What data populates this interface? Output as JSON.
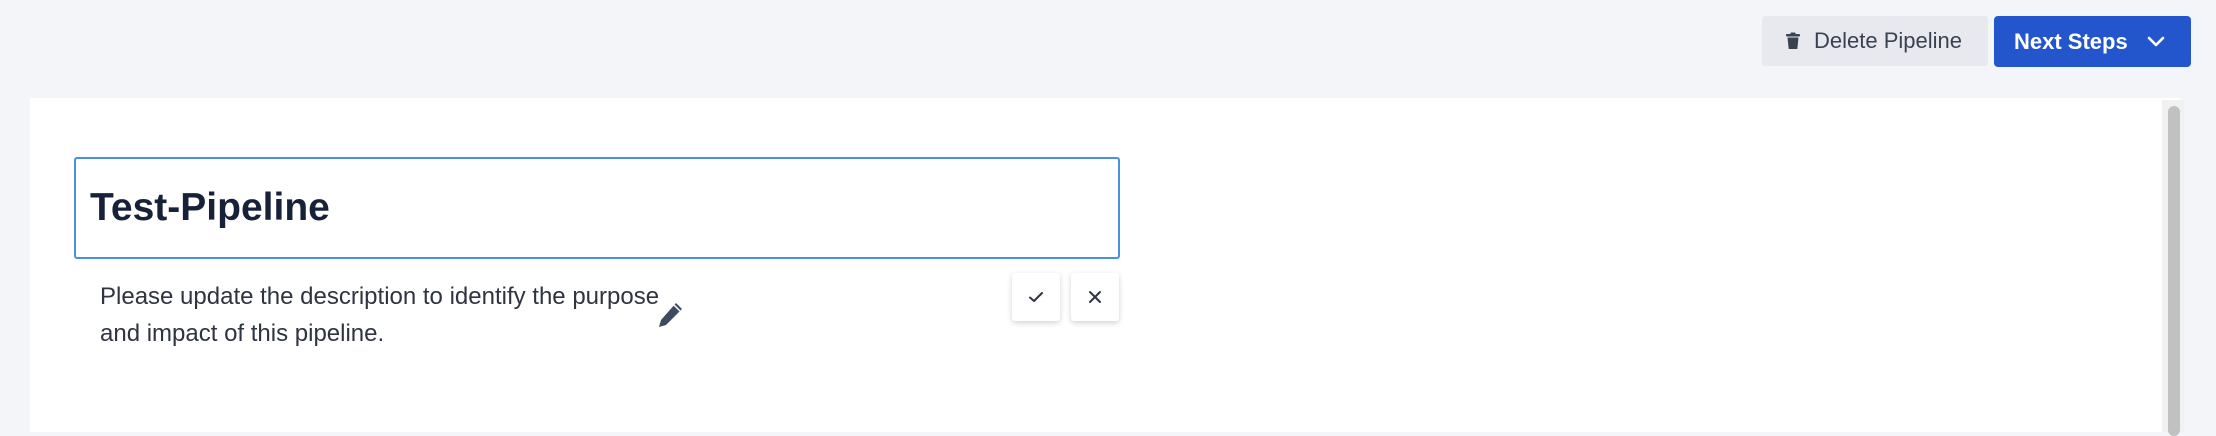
{
  "toolbar": {
    "delete_label": "Delete Pipeline",
    "delete_icon": "trash-icon",
    "next_label": "Next Steps",
    "next_icon": "chevron-down-icon"
  },
  "pipeline": {
    "name_value": "Test-Pipeline",
    "description": "Please update the description to identify the purpose and impact of this pipeline.",
    "edit_icon": "pencil-icon",
    "confirm_icon": "check-icon",
    "cancel_icon": "close-icon"
  },
  "colors": {
    "page_bg": "#f4f5f9",
    "primary": "#2356cc",
    "input_focus_border": "#4a90e2",
    "title_text": "#17223a",
    "secondary_button_bg": "#e7e9ee"
  }
}
